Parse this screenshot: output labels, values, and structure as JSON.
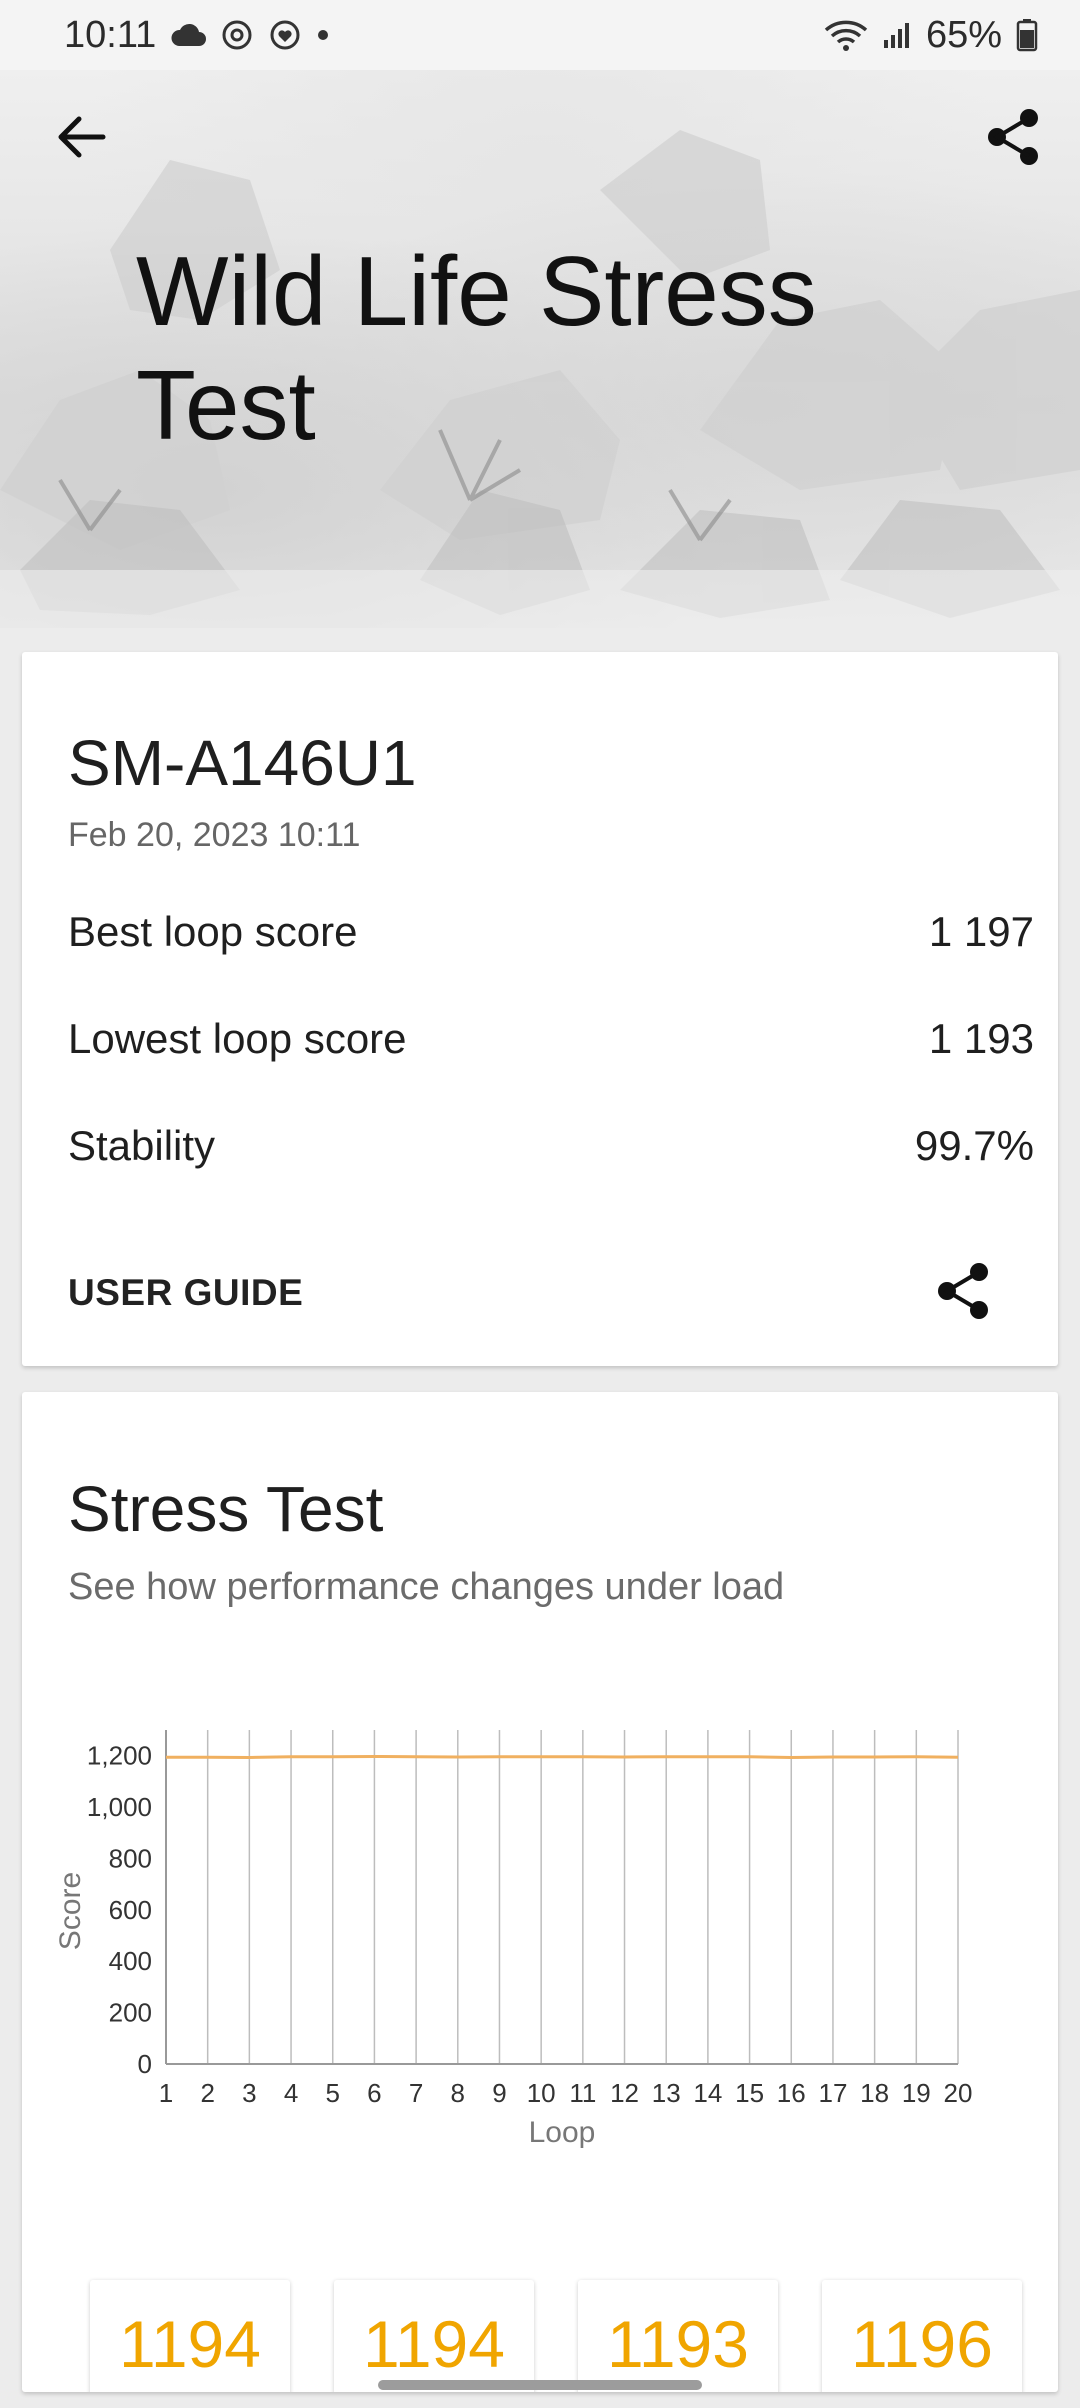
{
  "status_bar": {
    "time": "10:11",
    "battery_percent": "65%",
    "icons": [
      "cloud-icon",
      "sync-icon",
      "heart-sync-icon",
      "dot-icon",
      "wifi-icon",
      "signal-icon",
      "battery-icon"
    ]
  },
  "header": {
    "title": "Wild Life Stress Test",
    "back_icon": "arrow-left-icon",
    "share_icon": "share-icon"
  },
  "result_card": {
    "device": "SM-A146U1",
    "date": "Feb 20, 2023 10:11",
    "stats": [
      {
        "label": "Best loop score",
        "value": "1 197"
      },
      {
        "label": "Lowest loop score",
        "value": "1 193"
      },
      {
        "label": "Stability",
        "value": "99.7%"
      }
    ],
    "user_guide_label": "USER GUIDE",
    "share_icon": "share-icon"
  },
  "stress_card": {
    "title": "Stress Test",
    "subtitle": "See how performance changes under load",
    "tiles": [
      "1194",
      "1194",
      "1193",
      "1196"
    ]
  },
  "chart_data": {
    "type": "line",
    "xlabel": "Loop",
    "ylabel": "Score",
    "x": [
      1,
      2,
      3,
      4,
      5,
      6,
      7,
      8,
      9,
      10,
      11,
      12,
      13,
      14,
      15,
      16,
      17,
      18,
      19,
      20
    ],
    "y_ticks": [
      "0",
      "200",
      "400",
      "600",
      "800",
      "1,000",
      "1,200"
    ],
    "ylim": [
      0,
      1300
    ],
    "series": [
      {
        "values": [
          1194,
          1194,
          1193,
          1196,
          1196,
          1197,
          1196,
          1195,
          1196,
          1196,
          1196,
          1195,
          1196,
          1196,
          1196,
          1193,
          1195,
          1195,
          1196,
          1194
        ]
      }
    ],
    "line_color": "#f0b060",
    "grid": "vertical"
  },
  "colors": {
    "accent": "#f0a500",
    "line": "#f0b060"
  }
}
